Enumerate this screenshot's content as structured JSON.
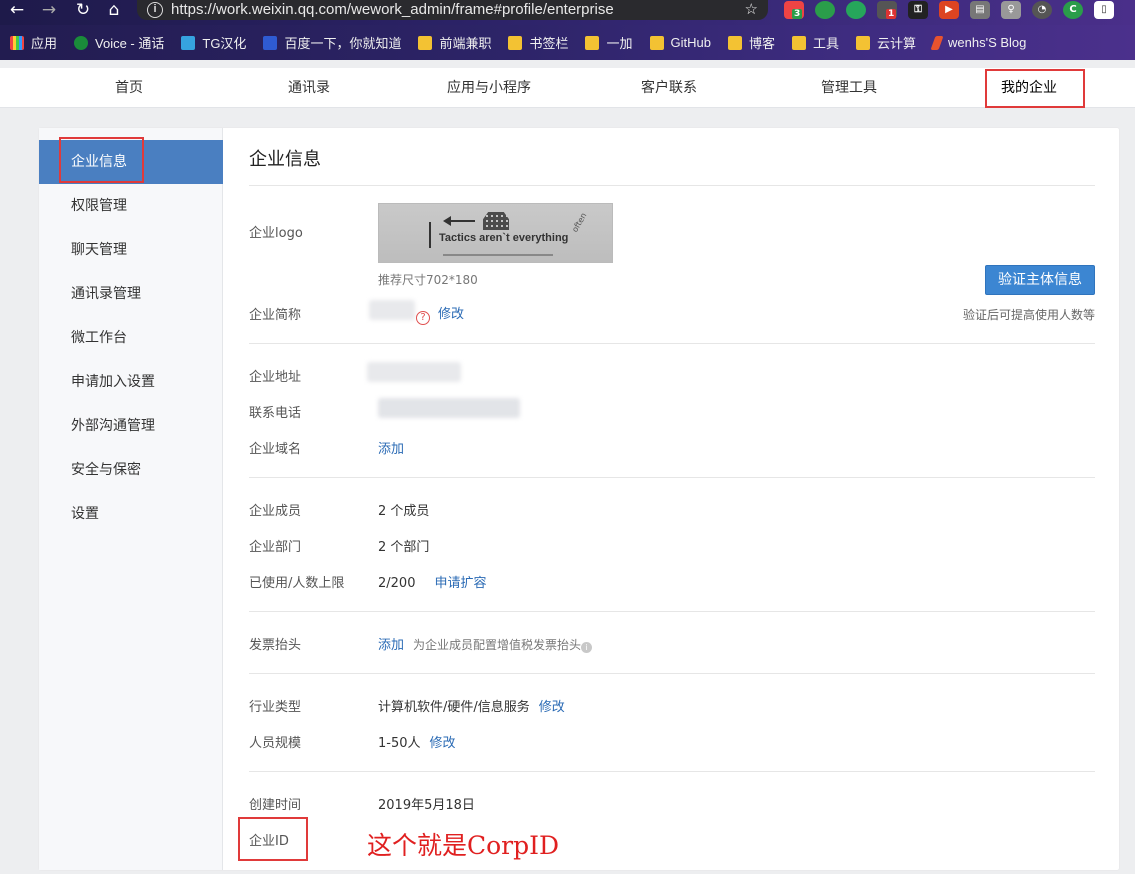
{
  "browser": {
    "url": "https://work.weixin.qq.com/wework_admin/frame#profile/enterprise",
    "bookmarks": [
      "应用",
      "Voice - 通话",
      "TG汉化",
      "百度一下，你就知道",
      "前端兼职",
      "书签栏",
      "一加",
      "GitHub",
      "博客",
      "工具",
      "云计算",
      "wenhs'S Blog"
    ],
    "ext_badges": [
      "3",
      "1"
    ]
  },
  "topnav": {
    "tabs": [
      "首页",
      "通讯录",
      "应用与小程序",
      "客户联系",
      "管理工具",
      "我的企业"
    ]
  },
  "sidebar": {
    "items": [
      "企业信息",
      "权限管理",
      "聊天管理",
      "通讯录管理",
      "微工作台",
      "申请加入设置",
      "外部沟通管理",
      "安全与保密",
      "设置"
    ]
  },
  "main": {
    "title": "企业信息",
    "logo_label": "企业logo",
    "logo_tagline": "Tactics aren`t everything",
    "logo_often": "often",
    "logo_hint": "推荐尺寸702*180",
    "verify_button": "验证主体信息",
    "verify_hint": "验证后可提高使用人数等",
    "short_name_label": "企业简称",
    "edit": "修改",
    "address_label": "企业地址",
    "phone_label": "联系电话",
    "domain_label": "企业域名",
    "add": "添加",
    "members_label": "企业成员",
    "members_value": "2 个成员",
    "departments_label": "企业部门",
    "departments_value": "2 个部门",
    "usage_label": "已使用/人数上限",
    "usage_value": "2/200",
    "expand_link": "申请扩容",
    "invoice_label": "发票抬头",
    "invoice_hint": "为企业成员配置增值税发票抬头",
    "industry_label": "行业类型",
    "industry_value": "计算机软件/硬件/信息服务",
    "scale_label": "人员规模",
    "scale_value": "1-50人",
    "created_label": "创建时间",
    "created_value": "2019年5月18日",
    "corpid_label": "企业ID"
  },
  "annotation": "这个就是CorpID",
  "colors": {
    "accent": "#4a7fc1",
    "highlight_box": "#e03a3a",
    "annotation": "#e02020",
    "link": "#2b6bb5"
  }
}
